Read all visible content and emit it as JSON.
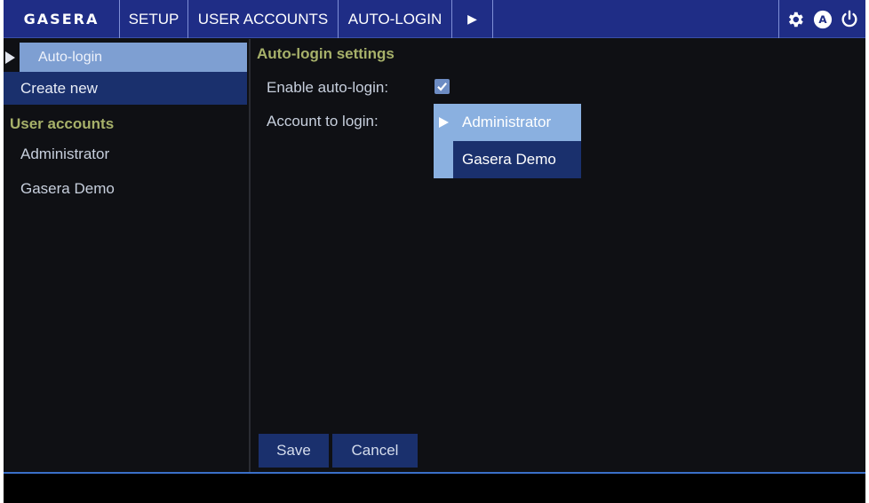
{
  "topbar": {
    "logo": "GASERA",
    "tabs": [
      {
        "label": "SETUP"
      },
      {
        "label": "USER ACCOUNTS"
      },
      {
        "label": "AUTO-LOGIN"
      },
      {
        "label": "▶"
      }
    ],
    "icons": {
      "settings": "gear-icon",
      "account": "A",
      "power": "power-icon"
    }
  },
  "sidebar": {
    "selected": "Auto-login",
    "create_new": "Create new",
    "accounts_heading": "User accounts",
    "accounts": [
      {
        "label": "Administrator"
      },
      {
        "label": "Gasera Demo"
      }
    ]
  },
  "main": {
    "heading": "Auto-login settings",
    "enable_label": "Enable auto-login:",
    "enable_checked": true,
    "account_label": "Account to login:",
    "account_options": [
      {
        "label": "Administrator",
        "selected": true
      },
      {
        "label": "Gasera Demo",
        "selected": false
      }
    ]
  },
  "buttons": {
    "save": "Save",
    "cancel": "Cancel"
  },
  "colors": {
    "topbar": "#1f2d86",
    "background": "#0f1014",
    "heading_accent": "#a7b16a",
    "selection": "#7e9fd2",
    "button": "#1a306d"
  }
}
